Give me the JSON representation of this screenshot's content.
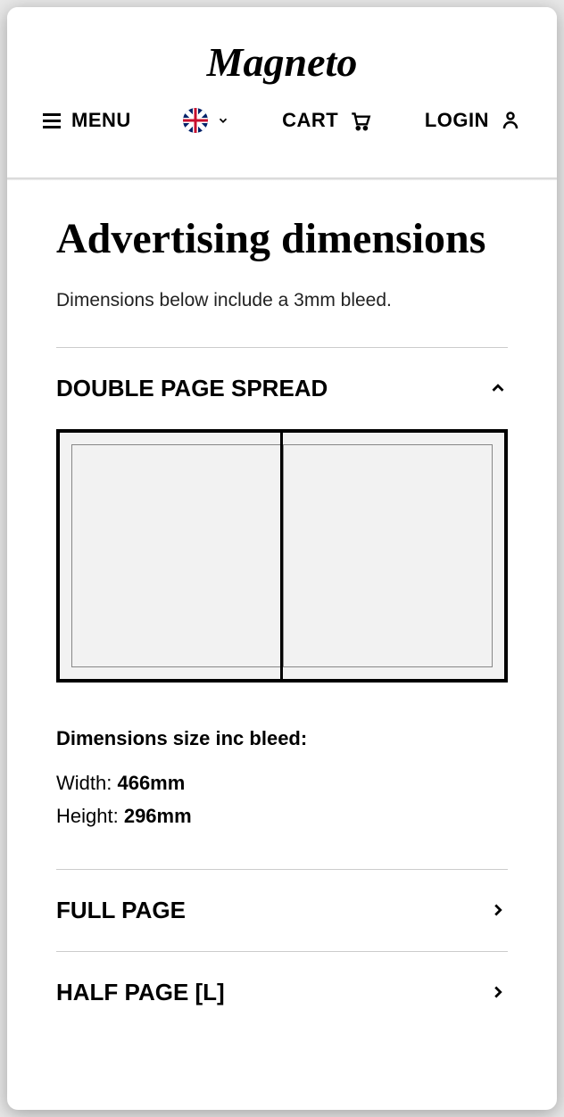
{
  "header": {
    "logo": "Magneto",
    "menu_label": "MENU",
    "cart_label": "CART",
    "login_label": "LOGIN"
  },
  "page": {
    "title": "Advertising dimensions",
    "subtitle": "Dimensions below include a 3mm bleed."
  },
  "accordion": {
    "expanded": {
      "title": "DOUBLE PAGE SPREAD",
      "dim_heading": "Dimensions size inc bleed:",
      "width_label": "Width: ",
      "width_value": "466mm",
      "height_label": "Height: ",
      "height_value": "296mm"
    },
    "collapsed": [
      {
        "title": "FULL PAGE"
      },
      {
        "title": "HALF PAGE [L]"
      }
    ]
  }
}
